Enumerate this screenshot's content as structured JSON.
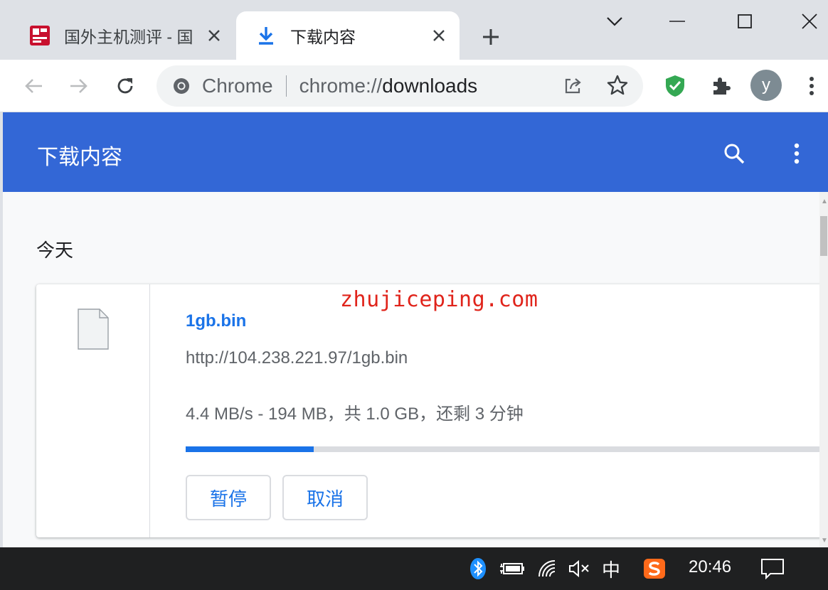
{
  "browser": {
    "tabs": [
      {
        "title": "国外主机测评 - 国",
        "favicon": "site-logo-red"
      },
      {
        "title": "下载内容",
        "favicon": "download-icon",
        "active": true
      }
    ],
    "omnibox": {
      "chip": "Chrome",
      "url_scheme": "chrome://",
      "url_host": "downloads"
    },
    "profile_initial": "y"
  },
  "downloads": {
    "header_title": "下载内容",
    "section_title": "今天",
    "item": {
      "file_name": "1gb.bin",
      "url": "http://104.238.221.97/1gb.bin",
      "status": "4.4 MB/s - 194 MB，共 1.0 GB，还剩 3 分钟",
      "progress_fraction": 0.2,
      "pause_label": "暂停",
      "cancel_label": "取消"
    }
  },
  "watermark": "zhujiceping.com",
  "taskbar": {
    "ime": "中",
    "clock": "20:46"
  },
  "colors": {
    "accent": "#3367d6",
    "link": "#1a73e8",
    "watermark": "#e0241b"
  }
}
